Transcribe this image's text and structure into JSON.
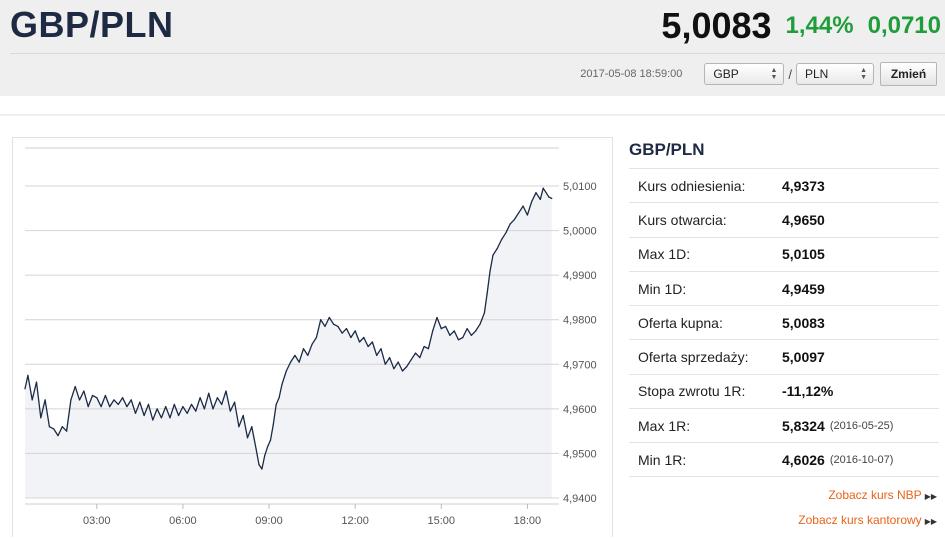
{
  "header": {
    "pair": "GBP/PLN",
    "rate": "5,0083",
    "change_pct": "1,44%",
    "change_abs": "0,0710",
    "timestamp": "2017-05-08 18:59:00",
    "from_currency": "GBP",
    "to_currency": "PLN",
    "separator": "/",
    "change_button": "Zmień"
  },
  "panel": {
    "title": "GBP/PLN",
    "stats": [
      {
        "label": "Kurs odniesienia:",
        "value": "4,9373",
        "date": ""
      },
      {
        "label": "Kurs otwarcia:",
        "value": "4,9650",
        "date": ""
      },
      {
        "label": "Max 1D:",
        "value": "5,0105",
        "date": ""
      },
      {
        "label": "Min 1D:",
        "value": "4,9459",
        "date": ""
      },
      {
        "label": "Oferta kupna:",
        "value": "5,0083",
        "date": ""
      },
      {
        "label": "Oferta sprzedaży:",
        "value": "5,0097",
        "date": ""
      },
      {
        "label": "Stopa zwrotu 1R:",
        "value": "-11,12%",
        "date": ""
      },
      {
        "label": "Max 1R:",
        "value": "5,8324",
        "date": "(2016-05-25)"
      },
      {
        "label": "Min 1R:",
        "value": "4,6026",
        "date": "(2016-10-07)"
      }
    ],
    "links": [
      {
        "label": "Zobacz kurs NBP"
      },
      {
        "label": "Zobacz kurs kantorowy"
      }
    ]
  },
  "colors": {
    "line": "#1b2a47",
    "area": "#f1f3f6",
    "positive": "#1f9d3a",
    "link": "#e8641a"
  },
  "chart_data": {
    "type": "area",
    "x_unit": "hour",
    "xlim": [
      0.5,
      19.1
    ],
    "ylim": [
      4.94,
      5.01
    ],
    "x_ticks": [
      {
        "value": 3,
        "label": "03:00"
      },
      {
        "value": 6,
        "label": "06:00"
      },
      {
        "value": 9,
        "label": "09:00"
      },
      {
        "value": 12,
        "label": "12:00"
      },
      {
        "value": 15,
        "label": "15:00"
      },
      {
        "value": 18,
        "label": "18:00"
      }
    ],
    "y_ticks": [
      {
        "value": 4.94,
        "label": "4,9400"
      },
      {
        "value": 4.95,
        "label": "4,9500"
      },
      {
        "value": 4.96,
        "label": "4,9600"
      },
      {
        "value": 4.97,
        "label": "4,9700"
      },
      {
        "value": 4.98,
        "label": "4,9800"
      },
      {
        "value": 4.99,
        "label": "4,9900"
      },
      {
        "value": 5.0,
        "label": "5,0000"
      },
      {
        "value": 5.01,
        "label": "5,0100"
      }
    ],
    "grid": true,
    "series": [
      {
        "points": [
          [
            0.5,
            4.9645
          ],
          [
            0.6,
            4.9675
          ],
          [
            0.75,
            4.962
          ],
          [
            0.9,
            4.966
          ],
          [
            1.05,
            4.958
          ],
          [
            1.2,
            4.962
          ],
          [
            1.35,
            4.956
          ],
          [
            1.5,
            4.9555
          ],
          [
            1.65,
            4.954
          ],
          [
            1.8,
            4.956
          ],
          [
            1.95,
            4.955
          ],
          [
            2.1,
            4.962
          ],
          [
            2.25,
            4.965
          ],
          [
            2.4,
            4.962
          ],
          [
            2.55,
            4.964
          ],
          [
            2.7,
            4.9605
          ],
          [
            2.85,
            4.963
          ],
          [
            3.0,
            4.9625
          ],
          [
            3.15,
            4.9605
          ],
          [
            3.3,
            4.963
          ],
          [
            3.45,
            4.9605
          ],
          [
            3.6,
            4.962
          ],
          [
            3.75,
            4.961
          ],
          [
            3.9,
            4.9625
          ],
          [
            4.05,
            4.9605
          ],
          [
            4.2,
            4.962
          ],
          [
            4.35,
            4.959
          ],
          [
            4.5,
            4.9615
          ],
          [
            4.65,
            4.9585
          ],
          [
            4.8,
            4.961
          ],
          [
            4.95,
            4.9575
          ],
          [
            5.1,
            4.96
          ],
          [
            5.25,
            4.958
          ],
          [
            5.4,
            4.9605
          ],
          [
            5.55,
            4.958
          ],
          [
            5.7,
            4.961
          ],
          [
            5.85,
            4.9585
          ],
          [
            6.0,
            4.9605
          ],
          [
            6.15,
            4.959
          ],
          [
            6.3,
            4.961
          ],
          [
            6.45,
            4.9595
          ],
          [
            6.6,
            4.9625
          ],
          [
            6.75,
            4.96
          ],
          [
            6.9,
            4.9635
          ],
          [
            7.05,
            4.96
          ],
          [
            7.2,
            4.9625
          ],
          [
            7.35,
            4.961
          ],
          [
            7.5,
            4.964
          ],
          [
            7.65,
            4.9595
          ],
          [
            7.8,
            4.9615
          ],
          [
            7.95,
            4.956
          ],
          [
            8.1,
            4.9585
          ],
          [
            8.25,
            4.9535
          ],
          [
            8.4,
            4.956
          ],
          [
            8.55,
            4.951
          ],
          [
            8.65,
            4.9475
          ],
          [
            8.75,
            4.9465
          ],
          [
            8.85,
            4.9495
          ],
          [
            8.95,
            4.9515
          ],
          [
            9.05,
            4.953
          ],
          [
            9.15,
            4.9565
          ],
          [
            9.25,
            4.961
          ],
          [
            9.35,
            4.9625
          ],
          [
            9.45,
            4.9655
          ],
          [
            9.6,
            4.9685
          ],
          [
            9.75,
            4.9705
          ],
          [
            9.9,
            4.972
          ],
          [
            10.05,
            4.9705
          ],
          [
            10.2,
            4.9735
          ],
          [
            10.35,
            4.972
          ],
          [
            10.5,
            4.9745
          ],
          [
            10.65,
            4.976
          ],
          [
            10.8,
            4.98
          ],
          [
            10.95,
            4.9785
          ],
          [
            11.1,
            4.9805
          ],
          [
            11.25,
            4.979
          ],
          [
            11.4,
            4.9785
          ],
          [
            11.55,
            4.977
          ],
          [
            11.7,
            4.978
          ],
          [
            11.85,
            4.976
          ],
          [
            12.0,
            4.9775
          ],
          [
            12.15,
            4.975
          ],
          [
            12.3,
            4.976
          ],
          [
            12.45,
            4.974
          ],
          [
            12.6,
            4.975
          ],
          [
            12.75,
            4.972
          ],
          [
            12.9,
            4.9735
          ],
          [
            13.05,
            4.97
          ],
          [
            13.2,
            4.9715
          ],
          [
            13.35,
            4.969
          ],
          [
            13.5,
            4.9705
          ],
          [
            13.65,
            4.9685
          ],
          [
            13.8,
            4.9695
          ],
          [
            13.95,
            4.971
          ],
          [
            14.1,
            4.9725
          ],
          [
            14.25,
            4.9715
          ],
          [
            14.4,
            4.974
          ],
          [
            14.55,
            4.9735
          ],
          [
            14.7,
            4.9775
          ],
          [
            14.85,
            4.9805
          ],
          [
            15.0,
            4.978
          ],
          [
            15.15,
            4.9785
          ],
          [
            15.3,
            4.9765
          ],
          [
            15.45,
            4.9775
          ],
          [
            15.6,
            4.9755
          ],
          [
            15.75,
            4.976
          ],
          [
            15.9,
            4.978
          ],
          [
            16.05,
            4.9765
          ],
          [
            16.2,
            4.9775
          ],
          [
            16.35,
            4.979
          ],
          [
            16.5,
            4.9815
          ],
          [
            16.6,
            4.986
          ],
          [
            16.7,
            4.991
          ],
          [
            16.8,
            4.9945
          ],
          [
            16.95,
            4.996
          ],
          [
            17.1,
            4.998
          ],
          [
            17.25,
            4.9995
          ],
          [
            17.4,
            5.0015
          ],
          [
            17.55,
            5.0025
          ],
          [
            17.7,
            5.004
          ],
          [
            17.85,
            5.0055
          ],
          [
            18.0,
            5.0035
          ],
          [
            18.15,
            5.0065
          ],
          [
            18.3,
            5.0085
          ],
          [
            18.45,
            5.007
          ],
          [
            18.55,
            5.0095
          ],
          [
            18.65,
            5.0085
          ],
          [
            18.75,
            5.0075
          ],
          [
            18.85,
            5.0072
          ]
        ]
      }
    ]
  }
}
